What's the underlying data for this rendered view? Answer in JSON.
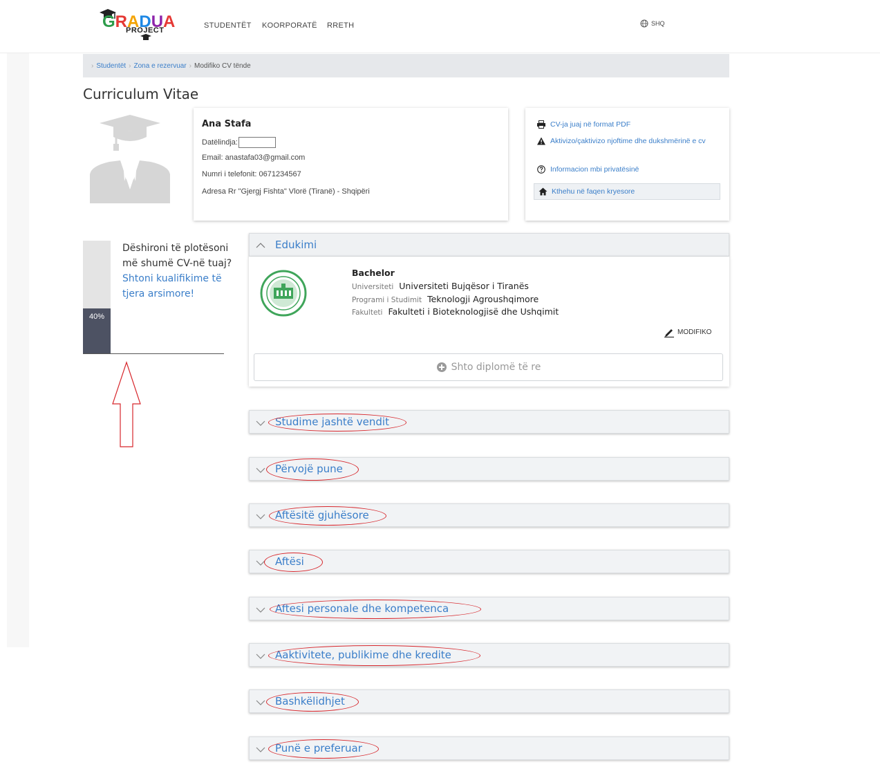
{
  "header": {
    "logo_text": "GRADUA",
    "logo_sub": "PROJECT",
    "nav": [
      "STUDENTËT",
      "KOORPORATË",
      "RRETH"
    ],
    "language": "SHQ"
  },
  "breadcrumb": {
    "items": [
      "Studentët",
      "Zona e rezervuar",
      "Modifiko CV tënde"
    ]
  },
  "page_title": "Curriculum Vitae",
  "profile": {
    "name": "Ana Stafa",
    "dob_label": "Datëlindja:",
    "email": "Email: anastafa03@gmail.com",
    "phone": "Numri i telefonit: 0671234567",
    "address": "Adresa Rr \"Gjergj Fishta\" Vlorë (Tiranë) - Shqipëri"
  },
  "links": {
    "pdf": "CV-ja juaj në format PDF",
    "notify": "Aktivizo/çaktivizo njoftime dhe dukshmërinë e cv",
    "privacy": "Informacion mbi privatësinë",
    "home": "Kthehu në faqen kryesore"
  },
  "progress": {
    "percent": 40,
    "label": "40%",
    "text_plain": "Dëshironi të plotësoni më shumë CV-në tuaj?",
    "text_link": "Shtoni kualifikime të tjera arsimore!"
  },
  "education": {
    "title": "Edukimi",
    "degree": "Bachelor",
    "university_label": "Universiteti",
    "university": "Universiteti Bujqësor i Tiranës",
    "program_label": "Programi i Studimit",
    "program": "Teknologji Agroushqimore",
    "faculty_label": "Fakulteti",
    "faculty": "Fakulteti i Bioteknologjisë dhe Ushqimit",
    "edit": "MODIFIKO",
    "add": "Shto diplomë të re"
  },
  "sections": [
    "Studime jashtë vendit",
    "Përvojë pune",
    "Aftësitë gjuhësore",
    "Aftësi",
    "Aftesi personale dhe kompetenca",
    "Aaktivitete, publikime dhe kredite",
    "Bashkëlidhjet",
    "Punë e preferuar"
  ],
  "colors": {
    "link": "#3a7ec9",
    "annotation": "#d7262b",
    "progress_fill": "#4d5263"
  }
}
